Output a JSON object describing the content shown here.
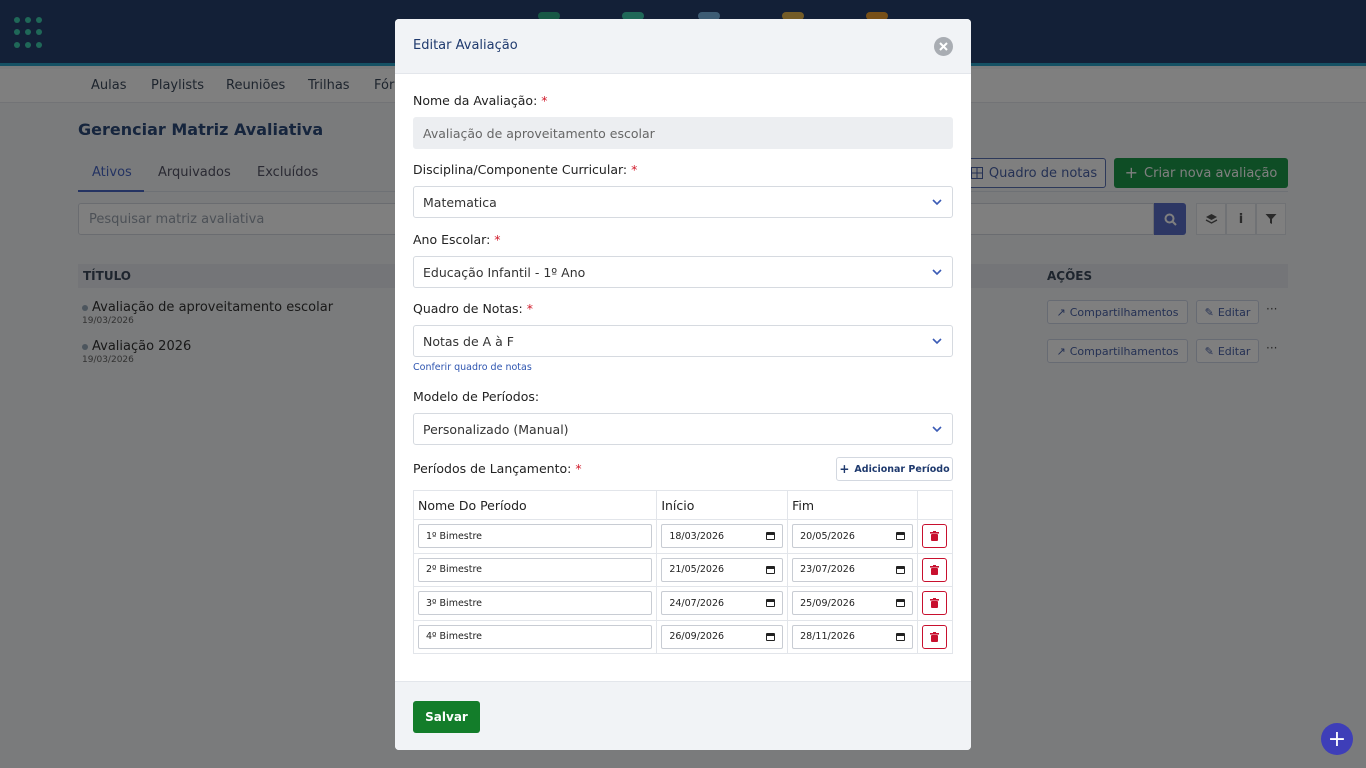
{
  "background": {
    "subnav": [
      "Aulas",
      "Playlists",
      "Reuniões",
      "Trilhas",
      "Fór"
    ],
    "page_title": "Gerenciar Matriz Avaliativa",
    "tabs": [
      "Ativos",
      "Arquivados",
      "Excluídos"
    ],
    "quadro_button": "Quadro de notas",
    "criar_button": "Criar nova avaliação",
    "search_placeholder": "Pesquisar matriz avaliativa",
    "table": {
      "headers": [
        "TÍTULO",
        "AÇÕES"
      ],
      "rows": [
        {
          "title": "Avaliação de aproveitamento escolar",
          "date": "19/03/2026"
        },
        {
          "title": "Avaliação 2026",
          "date": "19/03/2026"
        }
      ],
      "share_label": "Compartilhamentos",
      "edit_label": "Editar",
      "more_label": "···"
    }
  },
  "modal": {
    "title": "Editar Avaliação",
    "fields": {
      "nome": {
        "label": "Nome da Avaliação:",
        "value": "Avaliação de aproveitamento escolar"
      },
      "disciplina": {
        "label": "Disciplina/Componente Curricular:",
        "value": "Matematica"
      },
      "ano": {
        "label": "Ano Escolar:",
        "value": "Educação Infantil - 1º Ano"
      },
      "quadro": {
        "label": "Quadro de Notas:",
        "value": "Notas de A à F"
      },
      "modelo": {
        "label": "Modelo de Períodos:",
        "value": "Personalizado (Manual)"
      }
    },
    "required_mark": "*",
    "conferir_link": "Conferir quadro de notas",
    "periodos_label": "Períodos de Lançamento:",
    "add_period_label": "Adicionar Período",
    "periods_table": {
      "headers": [
        "Nome Do Período",
        "Início",
        "Fim"
      ],
      "rows": [
        {
          "name": "1º Bimestre",
          "start": "18/03/2026",
          "end": "20/05/2026"
        },
        {
          "name": "2º Bimestre",
          "start": "21/05/2026",
          "end": "23/07/2026"
        },
        {
          "name": "3º Bimestre",
          "start": "24/07/2026",
          "end": "25/09/2026"
        },
        {
          "name": "4º Bimestre",
          "start": "26/09/2026",
          "end": "28/11/2026"
        }
      ]
    },
    "save_label": "Salvar"
  },
  "fab_label": "+",
  "icons": [
    "apps-grid-icon",
    "close-icon",
    "chevron-down-icon",
    "plus-icon",
    "calendar-icon",
    "trash-icon",
    "search-icon",
    "layers-icon",
    "info-icon",
    "filter-icon",
    "grid-icon",
    "share-icon",
    "edit-icon"
  ],
  "colors": {
    "topbar": "#27416e",
    "accent": "#4967c4",
    "save": "#137d2a",
    "danger": "#c8102e",
    "required": "#d11a2a"
  }
}
